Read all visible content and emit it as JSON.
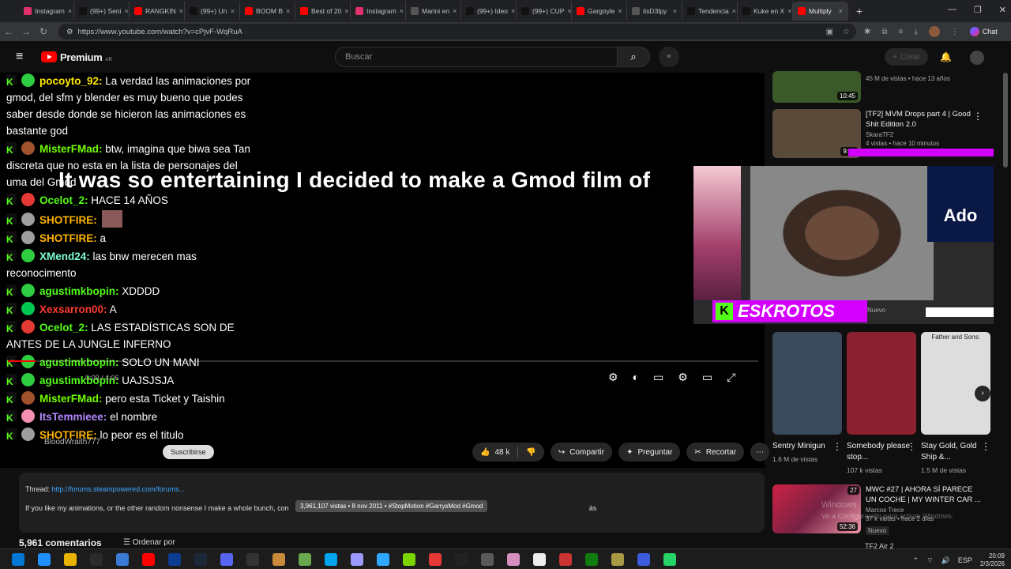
{
  "browser": {
    "tabs": [
      {
        "label": "Instagram",
        "color": "#e1306c"
      },
      {
        "label": "(99+) Seni",
        "color": "#111111"
      },
      {
        "label": "RANGKIN",
        "color": "#ff0000"
      },
      {
        "label": "(99+) Un",
        "color": "#111111"
      },
      {
        "label": "BOOM B",
        "color": "#ff0000"
      },
      {
        "label": "Best of 20",
        "color": "#ff0000"
      },
      {
        "label": "Instagram",
        "color": "#e1306c"
      },
      {
        "label": "Marini en",
        "color": "#555555"
      },
      {
        "label": "(99+) Ideo",
        "color": "#111111"
      },
      {
        "label": "(99+) CUP",
        "color": "#111111"
      },
      {
        "label": "Gargoyle",
        "color": "#ff0000"
      },
      {
        "label": "itsD3lpy",
        "color": "#555555"
      },
      {
        "label": "Tendencia",
        "color": "#111111"
      },
      {
        "label": "Kuke en X",
        "color": "#111111"
      },
      {
        "label": "Multiply",
        "color": "#ff0000"
      }
    ],
    "url": "https://www.youtube.com/watch?v=cPjvF-WqRuA",
    "chat_label": "Chat"
  },
  "youtube": {
    "logo_text": "Premium",
    "logo_region": "AR",
    "search_placeholder": "Buscar",
    "create_label": "Crear"
  },
  "video": {
    "subtitle": "It was so entertaining I decided to make a Gmod film of",
    "time": "0:09 / 4:06",
    "progress_fraction": 0.037,
    "ghost_text": "BloodWraith777",
    "subscribe_label": "Suscribirse",
    "chat": [
      {
        "user": "pocoyto_92:",
        "text": "La verdad las animaciones por gmod, del sfm y blender es muy bueno que podes saber desde donde se hicieron las animaciones es bastante god",
        "color": "#ffe900",
        "badge": "#2ecc40"
      },
      {
        "user": "MisterFMad:",
        "text": "btw, imagina que biwa sea Tan discreta que no esta en la lista de personajes del uma del Gmod",
        "color": "#73ff00",
        "badge": "#a0522d"
      },
      {
        "user": "Ocelot_2:",
        "text": "HACE 14 AÑOS",
        "color": "#53fc18",
        "badge": "#e53935"
      },
      {
        "user": "SHOTFIRE:",
        "text": "",
        "color": "#ffb300",
        "badge": "#9e9e9e"
      },
      {
        "user": "SHOTFIRE:",
        "text": "a",
        "color": "#ffb300",
        "badge": "#9e9e9e"
      },
      {
        "user": "XMend24:",
        "text": "las bnw merecen mas reconocimento",
        "color": "#7fffd4",
        "badge": "#2ecc40"
      },
      {
        "user": "agustimkbopin:",
        "text": "XDDDD",
        "color": "#53fc18",
        "badge": "#2ecc40"
      },
      {
        "user": "Xexsarron00:",
        "text": "A",
        "color": "#ff3b30",
        "badge": "#00c853"
      },
      {
        "user": "Ocelot_2:",
        "text": "LAS ESTADÍSTICAS SON DE ANTES DE LA JUNGLE INFERNO",
        "color": "#53fc18",
        "badge": "#e53935"
      },
      {
        "user": "agustimkbopin:",
        "text": "SOLO UN MANI",
        "color": "#53fc18",
        "badge": "#2ecc40"
      },
      {
        "user": "agustimkbopin:",
        "text": "UAJSJSJA",
        "color": "#53fc18",
        "badge": "#2ecc40"
      },
      {
        "user": "MisterFMad:",
        "text": "pero esta Ticket y Taishin",
        "color": "#73ff00",
        "badge": "#a0522d"
      },
      {
        "user": "ItsTemmieee:",
        "text": "el nombre",
        "color": "#b388ff",
        "badge": "#f48fb1"
      },
      {
        "user": "SHOTFIRE:",
        "text": "lo peor es el titulo",
        "color": "#ffb300",
        "badge": "#9e9e9e"
      }
    ]
  },
  "actions": {
    "likes": "48 k",
    "share": "Compartir",
    "ask": "Preguntar",
    "clip": "Recortar"
  },
  "description": {
    "thread_label": "Thread:",
    "thread_link": "http://forums.steampowered.com/forums...",
    "tooltip": "3,961,107 vistas • 8 nov 2011 • #StopMotion #GarrysMod #Gmod",
    "body": "If you like my animations, or the other random nonsense I make a whole bunch, con",
    "body_tail": "ás",
    "comments_count": "5,961 comentarios",
    "sort_label": "Ordenar por"
  },
  "sidebar": {
    "videos": [
      {
        "title": "",
        "meta": "45 M de vistas • hace 13 años",
        "duration": "10:45",
        "thumb": "#3a5a2a"
      },
      {
        "title": "[TF2] MVM Drops part 4 | Good Shit Edition 2.0",
        "channel": "SkaraTF2",
        "meta": "4 vistas • hace 10 minutos",
        "duration": "9:14",
        "thumb": "#5a4a3a"
      }
    ],
    "shorts": [
      {
        "title": "Sentry Minigun",
        "meta": "1.6 M de vistas",
        "thumb": "#3b4a5a"
      },
      {
        "title": "Somebody please stop...",
        "meta": "107 k vistas",
        "thumb": "#8a2030"
      },
      {
        "title": "Stay Gold, Gold Ship &...",
        "meta": "1.5 M de vistas",
        "thumb": "#ddd",
        "overlay": "Father and Sons:"
      }
    ],
    "bottom": {
      "title": "MWC #27 | AHORA SÍ PARECE UN COCHE | MY WINTER CAR ...",
      "channel": "Marcos Trece",
      "meta": "37 k vistas • hace 2 días",
      "badge": "Nuevo",
      "duration": "52:36",
      "count": "27"
    },
    "next_title": "TF2 Air 2"
  },
  "webcam": {
    "name": "ESKROTOS",
    "k_label": "K",
    "brand": "Ado",
    "nuevo": "Nuevo"
  },
  "windows": {
    "watermark1": "Windows",
    "watermark2": "Ve a Configuración para activar Windows.",
    "lang": "ESP",
    "time": "20:09",
    "date": "2/3/2026"
  }
}
